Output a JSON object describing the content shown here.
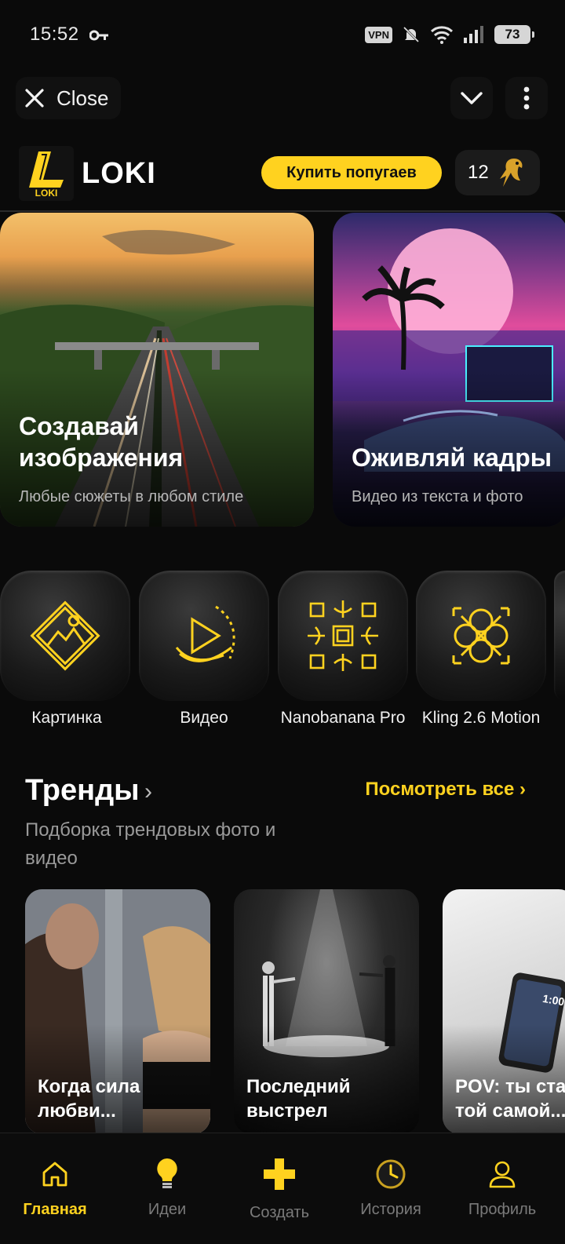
{
  "status_bar": {
    "time": "15:52",
    "vpn": "VPN",
    "battery": "73"
  },
  "top_bar": {
    "close_label": "Close"
  },
  "brand": {
    "name": "LOKI",
    "logo_text": "LOKI"
  },
  "header": {
    "buy_label": "Купить попугаев",
    "balance": "12"
  },
  "hero_cards": [
    {
      "title": "Создавай изображения",
      "subtitle": "Любые сюжеты в любом стиле"
    },
    {
      "title": "Оживляй кадры",
      "subtitle": "Видео из текста и фото"
    }
  ],
  "tools": [
    {
      "label": "Картинка",
      "icon": "mountain-diamond-icon"
    },
    {
      "label": "Видео",
      "icon": "play-swirl-icon"
    },
    {
      "label": "Nanobanana Pro",
      "icon": "banana-chip-icon"
    },
    {
      "label": "Kling 2.6 Motion",
      "icon": "knot-arrows-icon"
    }
  ],
  "trends": {
    "title": "Тренды",
    "see_all": "Посмотреть все ›",
    "subtitle": "Подборка трендовых фото и видео",
    "items": [
      {
        "title": "Когда сила любви..."
      },
      {
        "title": "Последний выстрел"
      },
      {
        "title": "POV: ты ста той самой..."
      }
    ]
  },
  "bottom_nav": [
    {
      "label": "Главная",
      "icon": "home-icon",
      "active": true
    },
    {
      "label": "Идеи",
      "icon": "lightbulb-icon",
      "active": false
    },
    {
      "label": "Создать",
      "icon": "plus-icon",
      "active": false
    },
    {
      "label": "История",
      "icon": "clock-icon",
      "active": false
    },
    {
      "label": "Профиль",
      "icon": "profile-icon",
      "active": false
    }
  ],
  "colors": {
    "accent": "#ffd21f",
    "background": "#0a0a0a",
    "muted": "#9a9a9a"
  }
}
